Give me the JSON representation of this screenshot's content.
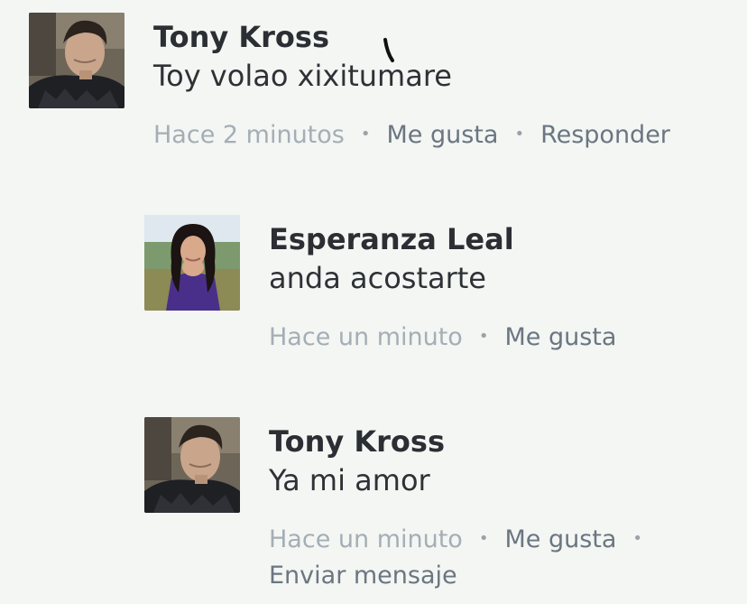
{
  "comments": [
    {
      "author": "Tony Kross",
      "text": "Toy volao xixitumare",
      "time": "Hace 2 minutos",
      "actions": [
        "Me gusta",
        "Responder"
      ]
    },
    {
      "author": "Esperanza Leal",
      "text": "anda acostarte",
      "time": "Hace un minuto",
      "actions": [
        "Me gusta"
      ]
    },
    {
      "author": "Tony Kross",
      "text": "Ya mi amor",
      "time": "Hace un minuto",
      "actions": [
        "Me gusta",
        "Enviar mensaje"
      ]
    }
  ],
  "colors": {
    "background": "#f3f6f3",
    "author": "#2b2f33",
    "meta_link": "#6b7681",
    "timestamp": "#a5aeb5"
  },
  "icons": [
    "avatar-photo-tony",
    "avatar-photo-esperanza",
    "separator-dot"
  ]
}
